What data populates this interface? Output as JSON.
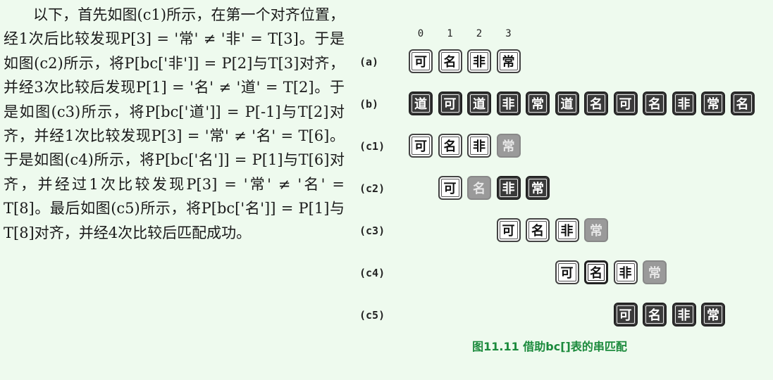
{
  "paragraph": "以下，首先如图(c1)所示，在第一个对齐位置，经1次后比较发现P[3] = '常' ≠ '非' = T[3]。于是如图(c2)所示，将P[bc['非']] = P[2]与T[3]对齐，并经3次比较后发现P[1] = '名' ≠ '道' = T[2]。于是如图(c3)所示，将P[bc['道']] = P[-1]与T[2]对齐，并经1次比较发现P[3] = '常' ≠ '名' = T[6]。于是如图(c4)所示，将P[bc['名']] = P[1]与T[6]对齐，并经过1次比较发现P[3] = '常' ≠ '名' = T[8]。最后如图(c5)所示，将P[bc['名']] = P[1]与T[8]对齐，并经4次比较后匹配成功。",
  "figure": {
    "indices": [
      "0",
      "1",
      "2",
      "3"
    ],
    "rows": [
      {
        "label": "(a)",
        "cells": [
          {
            "c": "可",
            "s": "white"
          },
          {
            "c": "名",
            "s": "white"
          },
          {
            "c": "非",
            "s": "white"
          },
          {
            "c": "常",
            "s": "white"
          }
        ]
      },
      {
        "label": "(b)",
        "cells": [
          {
            "c": "道",
            "s": "dark"
          },
          {
            "c": "可",
            "s": "dark"
          },
          {
            "c": "道",
            "s": "dark"
          },
          {
            "c": "非",
            "s": "dark"
          },
          {
            "c": "常",
            "s": "dark"
          },
          {
            "c": "道",
            "s": "dark"
          },
          {
            "c": "名",
            "s": "dark"
          },
          {
            "c": "可",
            "s": "dark"
          },
          {
            "c": "名",
            "s": "dark"
          },
          {
            "c": "非",
            "s": "dark"
          },
          {
            "c": "常",
            "s": "dark"
          },
          {
            "c": "名",
            "s": "dark"
          }
        ]
      },
      {
        "label": "(c1)",
        "offset": 0,
        "cells": [
          {
            "c": "可",
            "s": "white"
          },
          {
            "c": "名",
            "s": "white"
          },
          {
            "c": "非",
            "s": "white"
          },
          {
            "c": "常",
            "s": "gray"
          }
        ]
      },
      {
        "label": "(c2)",
        "offset": 1,
        "cells": [
          {
            "c": "可",
            "s": "white"
          },
          {
            "c": "名",
            "s": "gray"
          },
          {
            "c": "非",
            "s": "dark"
          },
          {
            "c": "常",
            "s": "dark"
          }
        ]
      },
      {
        "label": "(c3)",
        "offset": 3,
        "cells": [
          {
            "c": "可",
            "s": "white"
          },
          {
            "c": "名",
            "s": "white"
          },
          {
            "c": "非",
            "s": "white"
          },
          {
            "c": "常",
            "s": "gray"
          }
        ]
      },
      {
        "label": "(c4)",
        "offset": 5,
        "cells": [
          {
            "c": "可",
            "s": "white"
          },
          {
            "c": "名",
            "s": "bold"
          },
          {
            "c": "非",
            "s": "white"
          },
          {
            "c": "常",
            "s": "gray"
          }
        ]
      },
      {
        "label": "(c5)",
        "offset": 7,
        "cells": [
          {
            "c": "可",
            "s": "dark"
          },
          {
            "c": "名",
            "s": "dark"
          },
          {
            "c": "非",
            "s": "dark"
          },
          {
            "c": "常",
            "s": "dark"
          }
        ]
      }
    ],
    "caption": "图11.11  借助bc[]表的串匹配"
  }
}
